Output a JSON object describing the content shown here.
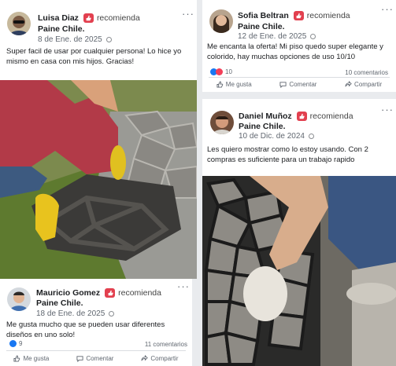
{
  "posts": [
    {
      "author": "Luisa Diaz",
      "recommends": "recomienda",
      "page": "Paine Chile.",
      "date": "8 de Ene. de 2025",
      "text": "Super facil de usar por cualquier persona! Lo hice yo mismo en casa con mis hijos. Gracias!"
    },
    {
      "author": "Sofia Beltran",
      "recommends": "recomienda",
      "page": "Paine Chile.",
      "date": "12 de Ene. de 2025",
      "text": "Me encanta la oferta! Mi piso quedo super elegante y colorido, hay muchas opciones de uso 10/10",
      "reactions": "10",
      "comments": "10 comentarios",
      "actions": {
        "like": "Me gusta",
        "comment": "Comentar",
        "share": "Compartir"
      }
    },
    {
      "author": "Daniel Muñoz",
      "recommends": "recomienda",
      "page": "Paine Chile.",
      "date": "10 de Dic. de 2024",
      "text": "Les quiero mostrar como lo estoy usando. Con 2 compras es suficiente para un trabajo rapido"
    },
    {
      "author": "Mauricio Gomez",
      "recommends": "recomienda",
      "page": "Paine Chile.",
      "date": "18 de Ene. de 2025",
      "text": "Me gusta mucho que se pueden usar diferentes diseños en uno solo!",
      "reactions": "9",
      "comments": "11 comentarios",
      "actions": {
        "like": "Me gusta",
        "comment": "Comentar",
        "share": "Compartir"
      }
    }
  ],
  "more_icon": "more-horizontal-icon",
  "colors": {
    "accent": "#1877f2",
    "badge": "#e2404f",
    "heart": "#f33e58"
  }
}
